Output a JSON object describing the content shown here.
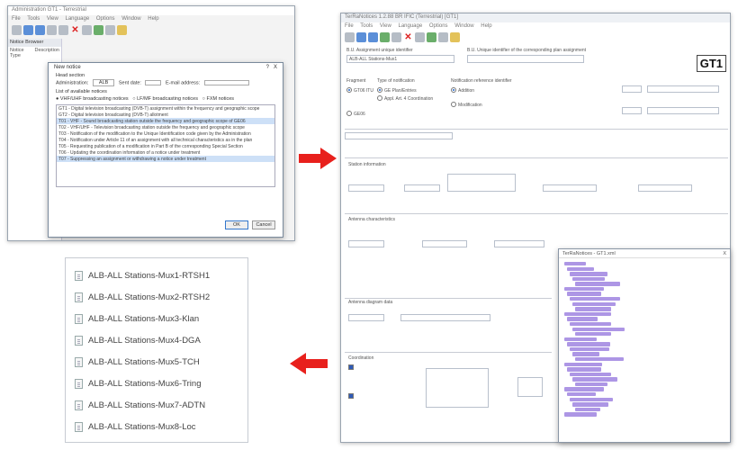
{
  "window1": {
    "title": "Administration GT1 - Terrestrial",
    "menu": [
      "File",
      "Tools",
      "View",
      "Language",
      "Options",
      "Window",
      "Help"
    ],
    "panel_title": "Notice Browser",
    "panel_cols": [
      "Notice Type",
      "Description"
    ]
  },
  "dialog": {
    "title": "New notice",
    "help": "?",
    "close": "X",
    "head_section": "Head section",
    "administration_label": "Administration:",
    "administration_value": "ALB",
    "sent_date_label": "Sent date:",
    "email_label": "E-mail address:",
    "list_label": "List of available notices",
    "radios": [
      "VHF/UHF broadcasting notices",
      "LF/MF broadcasting notices",
      "FXM notices"
    ],
    "notices": [
      "GT1 - Digital television broadcasting (DVB-T) assignment within the frequency and geographic scope",
      "GT2 - Digital television broadcasting (DVB-T) allotment",
      "T01 - VHF - Sound broadcasting station outside the frequency and geographic scope of GE06",
      "T02 - VHF/UHF - Television broadcasting station outside the frequency and geographic scope",
      "T03 - Notification of the modification to the Unique Identification code given by the Administration",
      "T04 - Notification under Article 11 of an assignment with all technical characteristics as in the plan",
      "T05 - Requesting publication of a modification in Part B of the corresponding Special Section",
      "T06 - Updating the coordination information of a notice under treatment",
      "T07 - Suppressing an assignment or withdrawing a notice under treatment"
    ],
    "ok": "OK",
    "cancel": "Cancel"
  },
  "window2": {
    "title": "TerRaNotices 1.2.88 BR IFIC (Terrestrial) [GT1]",
    "menu": [
      "File",
      "Tools",
      "View",
      "Language",
      "Options",
      "Window",
      "Help"
    ],
    "gt1": "GT1",
    "uid_label": "B.U. Assignment unique identifier",
    "uid2_label": "B.U. Unique identifier of the corresponding plan assignment",
    "uid_value": "ALB-ALL Stations-Mux1",
    "fragment": "Fragment",
    "frag_opts": [
      "GT06 ITU",
      "GE06"
    ],
    "type_of_notification": "Type of notification",
    "type_opts": [
      "GE Plan/Entries",
      "Appl. Art. 4 Coordination"
    ],
    "notification_id": "Notification reference identifier",
    "notif_opts": [
      "Addition",
      "Modification"
    ],
    "site_info": "Station information",
    "antenna_char": "Antenna characteristics",
    "antenna_data": "Antenna diagram data",
    "coordination": "Coordination"
  },
  "xml_window": {
    "title": "TerRaNotices - GT1.xml",
    "close": "X"
  },
  "station_list": [
    "ALB-ALL Stations-Mux1-RTSH1",
    "ALB-ALL Stations-Mux2-RTSH2",
    "ALB-ALL Stations-Mux3-Klan",
    "ALB-ALL Stations-Mux4-DGA",
    "ALB-ALL Stations-Mux5-TCH",
    "ALB-ALL Stations-Mux6-Tring",
    "ALB-ALL Stations-Mux7-ADTN",
    "ALB-ALL Stations-Mux8-Loc"
  ],
  "colors": {
    "arrow": "#e8201c",
    "selection": "#cde0f7",
    "xml_text": "#6a3fd0"
  }
}
